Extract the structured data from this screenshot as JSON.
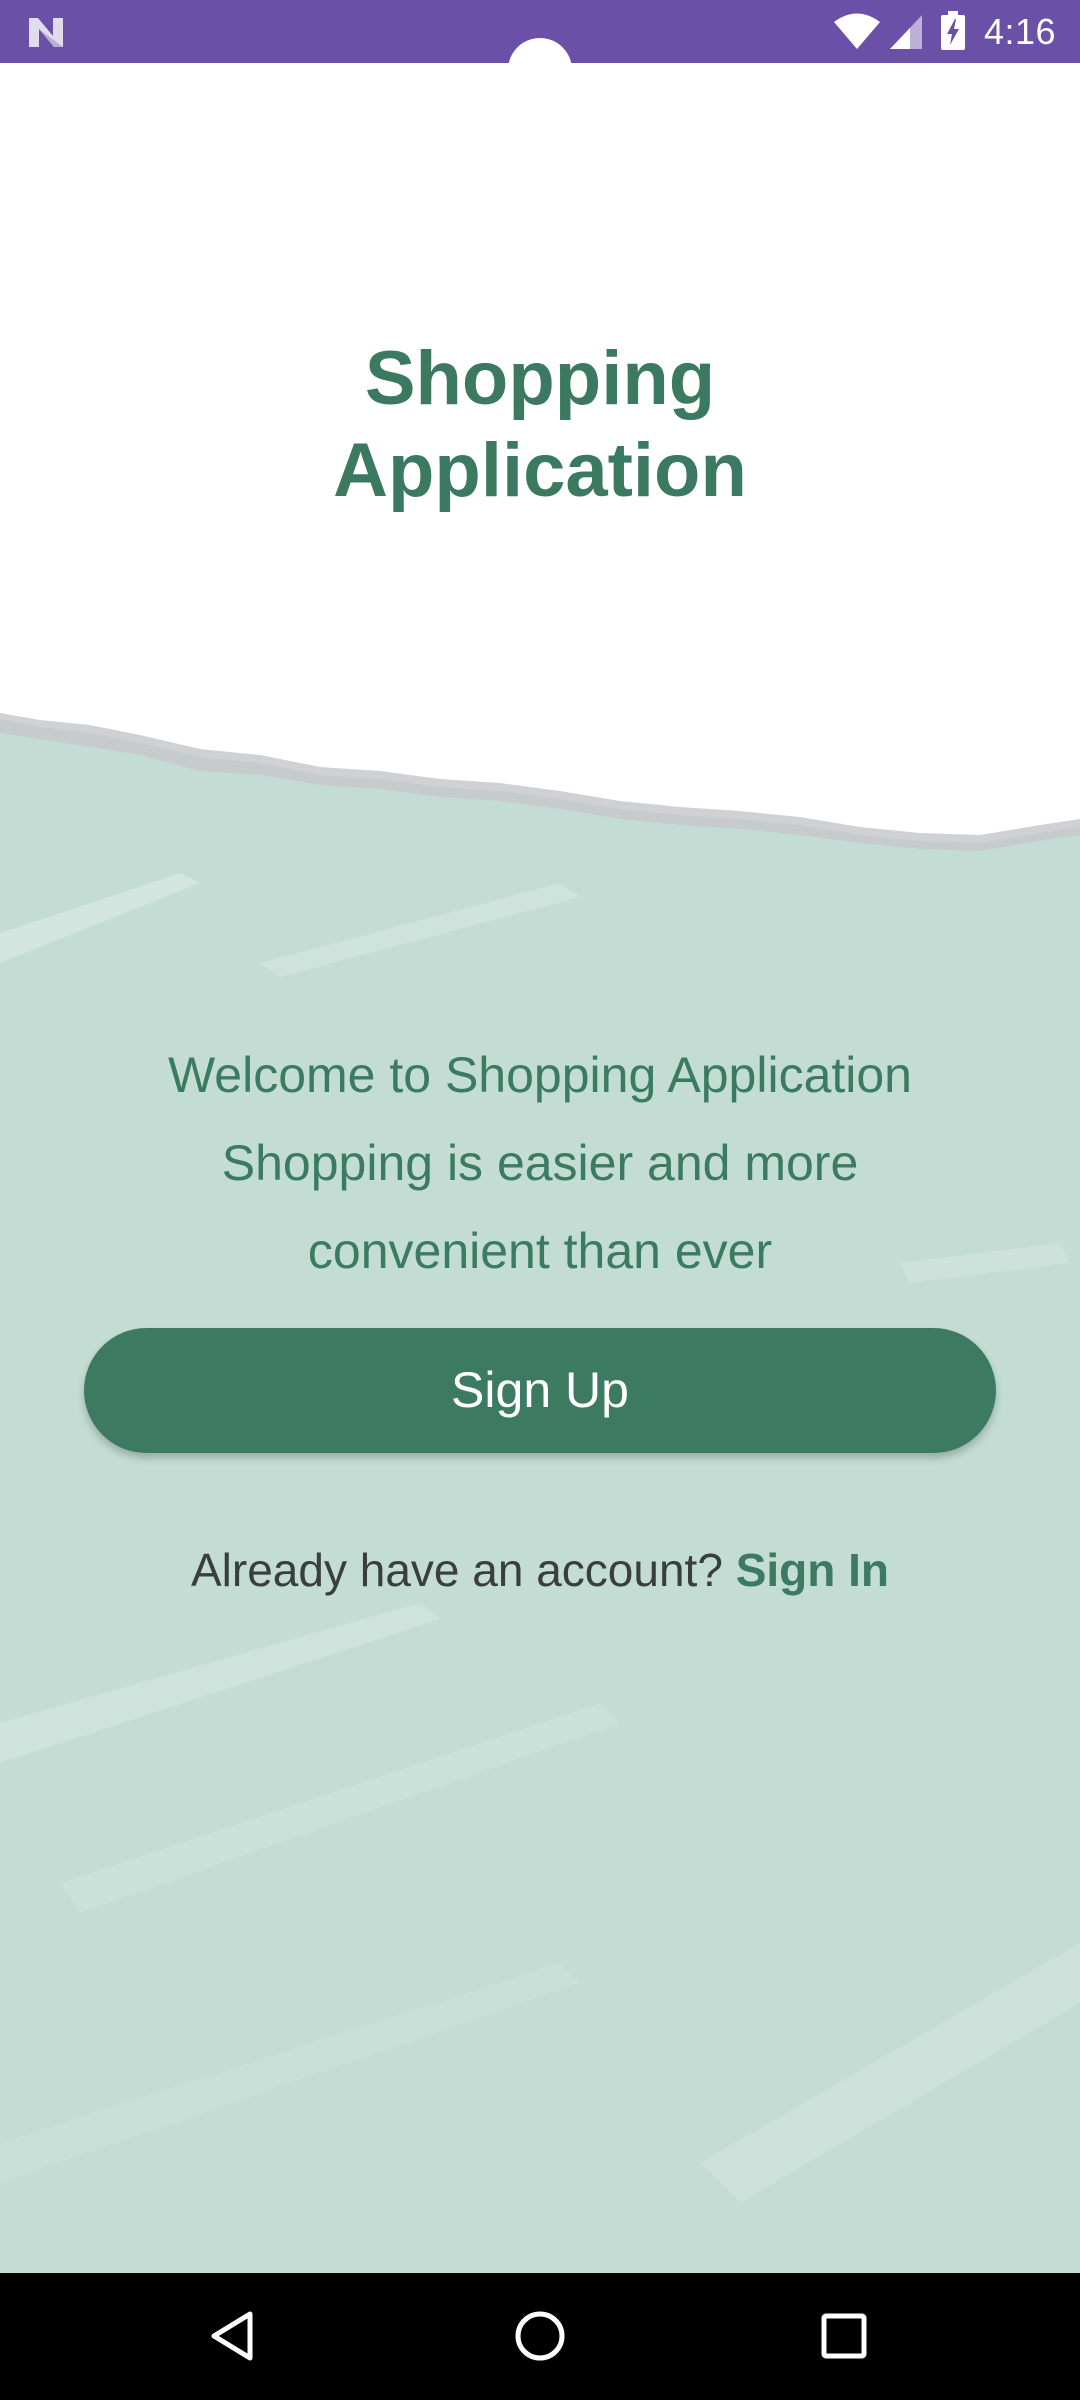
{
  "status_bar": {
    "time": "4:16",
    "app_icon": "n-logo-icon",
    "icons": [
      "wifi-icon",
      "cell-signal-icon",
      "battery-charging-icon"
    ],
    "background_color": "#6a50a7"
  },
  "main": {
    "title_lines": [
      "Shopping",
      "Application"
    ],
    "welcome_lines": [
      "Welcome to Shopping Application",
      "Shopping is easier and more",
      "convenient than ever"
    ],
    "signup_label": "Sign Up",
    "already_text": "Already have an account?",
    "signin_label": "Sign In",
    "colors": {
      "accent": "#3c7a62",
      "background_mint": "#c3ddd4"
    }
  },
  "nav_bar": {
    "buttons": [
      "back-icon",
      "home-icon",
      "recents-icon"
    ]
  }
}
